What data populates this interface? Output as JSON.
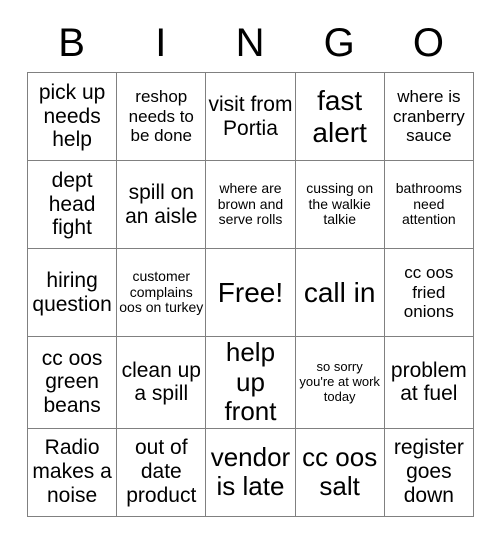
{
  "card": {
    "title": "BINGO",
    "header_letters": [
      "B",
      "I",
      "N",
      "G",
      "O"
    ],
    "columns": 5,
    "rows": 5,
    "free_space": "Free!",
    "colors": {
      "background": "#ffffff",
      "text": "#000000",
      "grid_line": "#808080"
    },
    "cells": [
      [
        {
          "text": "pick up needs help",
          "size": "lg"
        },
        {
          "text": "reshop needs to be done",
          "size": "md"
        },
        {
          "text": "visit from Portia",
          "size": "lg"
        },
        {
          "text": "fast alert",
          "size": "xxl"
        },
        {
          "text": "where is cranberry sauce",
          "size": "md"
        }
      ],
      [
        {
          "text": "dept head fight",
          "size": "lg"
        },
        {
          "text": "spill on an aisle",
          "size": "lg"
        },
        {
          "text": "where are brown and serve rolls",
          "size": "sm"
        },
        {
          "text": "cussing on the walkie talkie",
          "size": "sm"
        },
        {
          "text": "bathrooms need attention",
          "size": "sm"
        }
      ],
      [
        {
          "text": "hiring question",
          "size": "lg"
        },
        {
          "text": "customer complains oos on turkey",
          "size": "sm"
        },
        {
          "text": "Free!",
          "size": "xxl",
          "free": true
        },
        {
          "text": "call in",
          "size": "xxl"
        },
        {
          "text": "cc oos fried onions",
          "size": "md"
        }
      ],
      [
        {
          "text": "cc oos green beans",
          "size": "lg"
        },
        {
          "text": "clean up a spill",
          "size": "lg"
        },
        {
          "text": "help up front",
          "size": "xl"
        },
        {
          "text": "so sorry you're at work today",
          "size": "xs"
        },
        {
          "text": "problem at fuel",
          "size": "lg"
        }
      ],
      [
        {
          "text": "Radio makes a noise",
          "size": "lg"
        },
        {
          "text": "out of date product",
          "size": "lg"
        },
        {
          "text": "vendor is late",
          "size": "xl"
        },
        {
          "text": "cc oos salt",
          "size": "xl"
        },
        {
          "text": "register goes down",
          "size": "lg"
        }
      ]
    ]
  }
}
